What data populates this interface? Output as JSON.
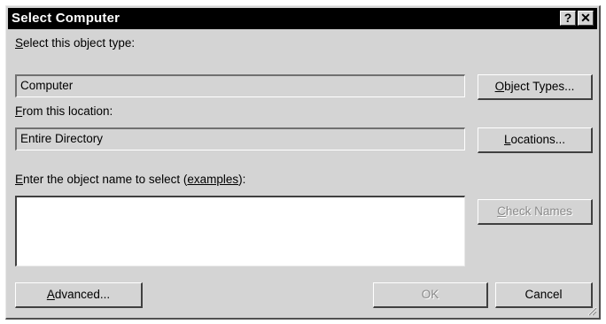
{
  "window": {
    "title": "Select Computer",
    "help_glyph": "?",
    "close_glyph": "✕"
  },
  "object_type": {
    "label_mnemonic": "S",
    "label_rest": "elect this object type:",
    "value": "Computer",
    "button_mnemonic": "O",
    "button_rest": "bject Types..."
  },
  "location": {
    "label_mnemonic": "F",
    "label_rest": "rom this location:",
    "value": "Entire Directory",
    "button_mnemonic": "L",
    "button_rest": "ocations..."
  },
  "object_name": {
    "label_mnemonic": "E",
    "label_rest": "nter the object name to select (",
    "link": "examples",
    "label_end": "):",
    "value": "",
    "check_mnemonic": "C",
    "check_rest": "heck Names"
  },
  "footer": {
    "advanced_mnemonic": "A",
    "advanced_rest": "dvanced...",
    "ok_label": "OK",
    "cancel_label": "Cancel"
  },
  "colors": {
    "dialog_face": "#d4d4d4",
    "titlebar": "#000000",
    "disabled_text": "#8a8a8a"
  }
}
